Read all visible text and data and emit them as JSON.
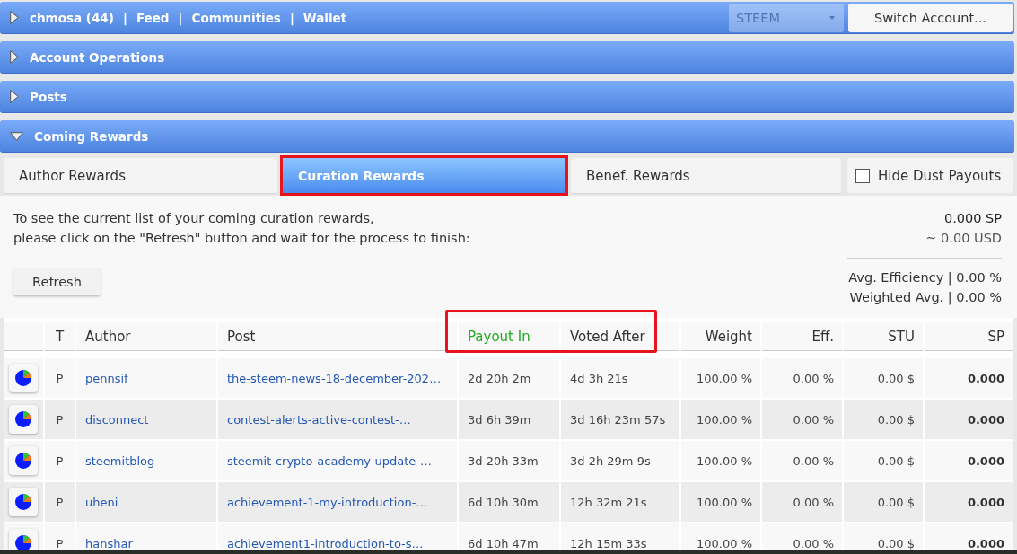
{
  "nav": {
    "expanded": false,
    "links": [
      {
        "label": "chmosa (44)",
        "separator": "|"
      },
      {
        "label": "Feed",
        "separator": "|"
      },
      {
        "label": "Communities",
        "separator": "|"
      },
      {
        "label": "Wallet"
      }
    ],
    "currency_select": {
      "value": "STEEM",
      "disabled": true
    },
    "switch_button": "Switch Account..."
  },
  "sections": [
    {
      "title": "Account Operations",
      "expanded": false
    },
    {
      "title": "Posts",
      "expanded": false
    },
    {
      "title": "Coming Rewards",
      "expanded": true
    }
  ],
  "tabs": [
    {
      "label": "Author Rewards",
      "selected": false,
      "highlighted": false
    },
    {
      "label": "Curation Rewards",
      "selected": true,
      "highlighted": true
    },
    {
      "label": "Benef. Rewards",
      "selected": false,
      "highlighted": false
    }
  ],
  "hide_dust": {
    "label": "Hide Dust Payouts",
    "checked": false
  },
  "info": {
    "lines": [
      "To see the current list of your coming curation rewards,",
      "please click on the \"Refresh\" button and wait for the process to finish:"
    ]
  },
  "refresh_button": "Refresh",
  "summary": {
    "sp": "0.000 SP",
    "usd": "~ 0.00 USD",
    "avg_efficiency": "Avg. Efficiency | 0.00 %",
    "weighted_avg": "Weighted Avg. | 0.00 %"
  },
  "table": {
    "columns": [
      {
        "label": "T",
        "kind": "type",
        "sorted": false,
        "highlighted": false
      },
      {
        "label": "Author",
        "kind": "link",
        "sorted": false,
        "highlighted": false
      },
      {
        "label": "Post",
        "kind": "link",
        "sorted": false,
        "highlighted": false
      },
      {
        "label": "Payout In",
        "kind": "text",
        "sorted": true,
        "highlighted": true
      },
      {
        "label": "Voted After",
        "kind": "text",
        "sorted": false,
        "highlighted": true
      },
      {
        "label": "Weight",
        "kind": "number",
        "sorted": false,
        "highlighted": false
      },
      {
        "label": "Eff.",
        "kind": "number",
        "sorted": false,
        "highlighted": false
      },
      {
        "label": "STU",
        "kind": "number",
        "sorted": false,
        "highlighted": false
      },
      {
        "label": "SP",
        "kind": "total",
        "sorted": false,
        "highlighted": false
      }
    ],
    "rows": [
      {
        "cells": [
          "P",
          "pennsif",
          "the-steem-news-18-december-202…",
          "2d 20h 2m",
          "4d 3h 21s",
          "100.00 %",
          "0.00 %",
          "0.00 $",
          "0.000"
        ]
      },
      {
        "cells": [
          "P",
          "disconnect",
          "contest-alerts-active-contest-…",
          "3d 6h 39m",
          "3d 16h 23m 57s",
          "100.00 %",
          "0.00 %",
          "0.00 $",
          "0.000"
        ]
      },
      {
        "cells": [
          "P",
          "steemitblog",
          "steemit-crypto-academy-update-…",
          "3d 20h 33m",
          "3d 2h 29m 9s",
          "100.00 %",
          "0.00 %",
          "0.00 $",
          "0.000"
        ]
      },
      {
        "cells": [
          "P",
          "uheni",
          "achievement-1-my-introduction-…",
          "6d 10h 30m",
          "12h 32m 21s",
          "100.00 %",
          "0.00 %",
          "0.00 $",
          "0.000"
        ]
      },
      {
        "cells": [
          "P",
          "hanshar",
          "achievement1-introduction-to-s…",
          "6d 10h 47m",
          "12h 15m 33s",
          "100.00 %",
          "0.00 %",
          "0.00 $",
          "0.000"
        ]
      }
    ]
  }
}
